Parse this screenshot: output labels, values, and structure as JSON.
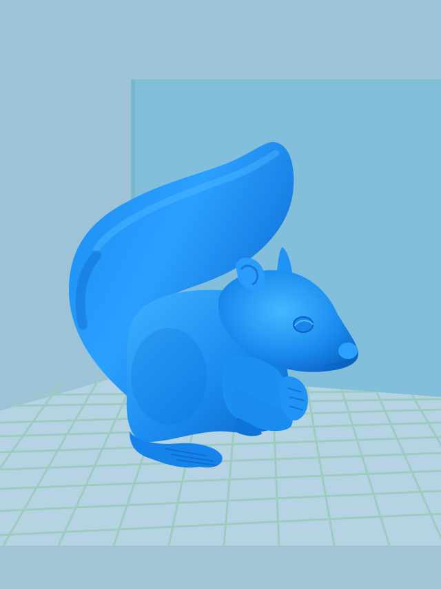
{
  "scene": {
    "subject": "squirrel-model",
    "colors": {
      "background": "#9cc4d6",
      "back_wall": "#83bfda",
      "side_wall": "#8fc0d4",
      "floor": "#b6d3e3",
      "grid_lines": "#9cccc0",
      "model_base": "#1a8cf0",
      "model_light": "#3fb2ff",
      "model_dark": "#0b63c4",
      "bottom_band": "#a4c5d6"
    }
  }
}
